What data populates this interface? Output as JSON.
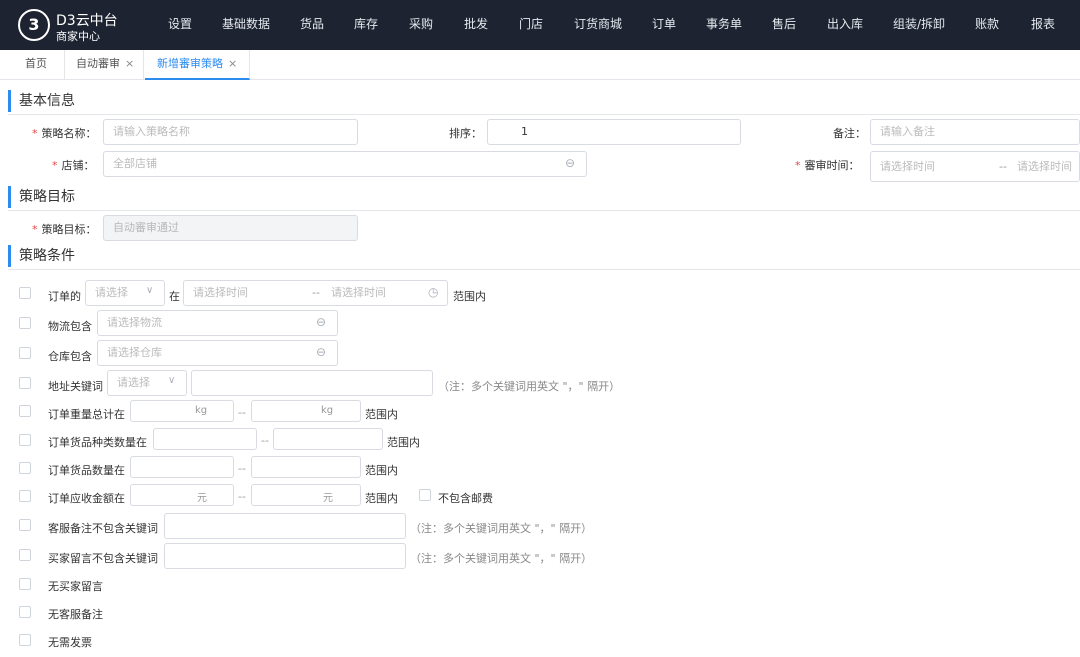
{
  "app": {
    "logo_text": "3",
    "brand_line1": "D3云中台",
    "brand_line2": "商家中心"
  },
  "nav": [
    "设置",
    "基础数据",
    "货品",
    "库存",
    "采购",
    "批发",
    "门店",
    "订货商城",
    "订单",
    "事务单",
    "售后",
    "出入库",
    "组装/拆卸",
    "账款",
    "报表"
  ],
  "tabs": [
    {
      "label": "首页"
    },
    {
      "label": "自动審审",
      "close": "×"
    },
    {
      "label": "新增審审策略",
      "close": "×"
    }
  ],
  "sections": {
    "basic": "基本信息",
    "target": "策略目标",
    "conditions": "策略条件"
  },
  "basic": {
    "required_mark": "*",
    "name_label": "策略名称：",
    "name_placeholder": "请输入策略名称",
    "sort_label": "排序：",
    "sort_value": "1",
    "remark_label": "备注：",
    "remark_placeholder": "请输入备注",
    "shop_label": "店铺：",
    "shop_placeholder": "全部店铺",
    "time_label": "審审时间：",
    "time_start": "请选择时间",
    "time_sep": "--",
    "time_end": "请选择时间"
  },
  "target": {
    "label": "策略目标：",
    "value": "自动審审通过"
  },
  "conditions": {
    "order_prefix": "订单的",
    "order_select": "请选择",
    "order_in": "在",
    "order_start": "请选择时间",
    "order_sep": "--",
    "order_end": "请选择时间",
    "order_suffix": "范围内",
    "logistics_label": "物流包含",
    "logistics_placeholder": "请选择物流",
    "warehouse_label": "仓库包含",
    "warehouse_placeholder": "请选择仓库",
    "address_label": "地址关键词",
    "address_select": "请选择",
    "address_note": "（注：多个关键词用英文 \"，\" 隔开）",
    "weight_label": "订单重量总计在",
    "weight_unit": "kg",
    "range_sep": "--",
    "range_suffix": "范围内",
    "kinds_label": "订单货品种类数量在",
    "qty_label": "订单货品数量在",
    "amount_label": "订单应收金额在",
    "amount_unit": "元",
    "no_shipping_label": "不包含邮费",
    "service_label": "客服备注不包含关键词",
    "service_note": "（注：多个关键词用英文 \"，\" 隔开）",
    "buyer_label": "买家留言不包含关键词",
    "buyer_note": "（注：多个关键词用英文 \"，\" 隔开）",
    "no_buyer_msg": "无买家留言",
    "no_service_remark": "无客服备注",
    "no_invoice": "无需发票"
  },
  "colors": {
    "topbar": "#1d2330",
    "accent": "#2d8cf0",
    "required": "#e5484d"
  }
}
